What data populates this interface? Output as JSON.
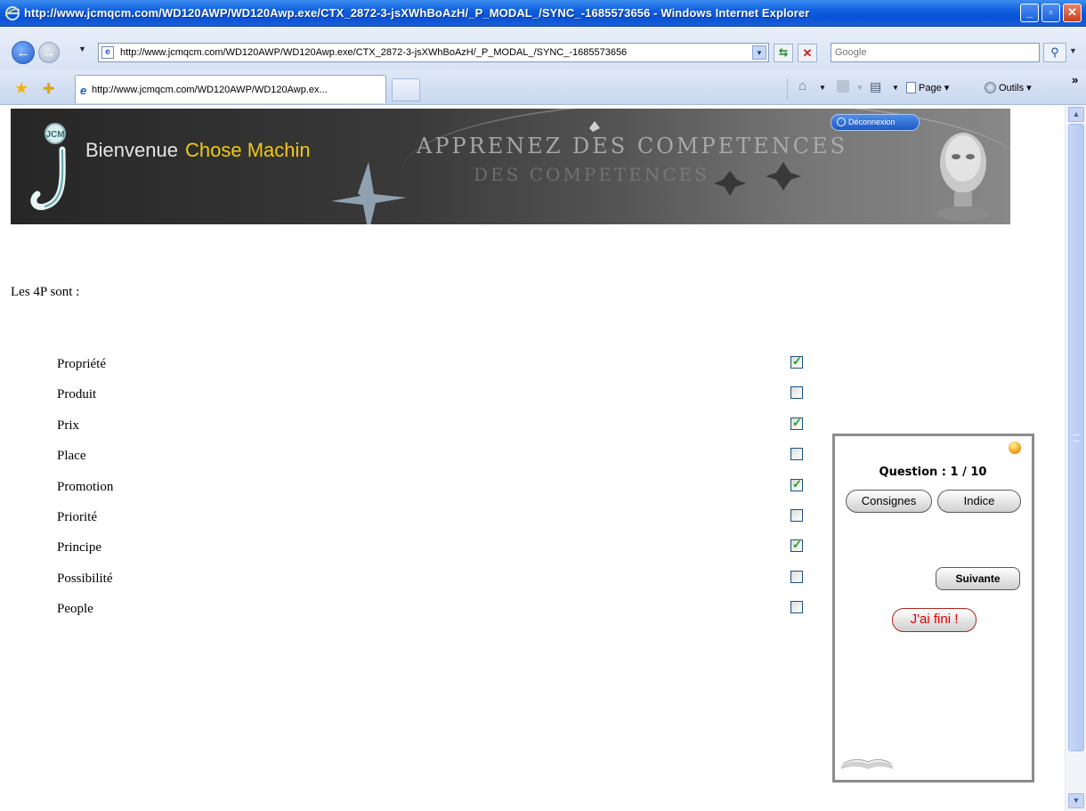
{
  "window": {
    "title": "http://www.jcmqcm.com/WD120AWP/WD120Awp.exe/CTX_2872-3-jsXWhBoAzH/_P_MODAL_/SYNC_-1685573656 - Windows Internet Explorer"
  },
  "address_bar": {
    "url": "http://www.jcmqcm.com/WD120AWP/WD120Awp.exe/CTX_2872-3-jsXWhBoAzH/_P_MODAL_/SYNC_-1685573656",
    "search_placeholder": "Google"
  },
  "tabs": {
    "active_label": "http://www.jcmqcm.com/WD120AWP/WD120Awp.ex..."
  },
  "command_bar": {
    "page_label": "Page",
    "tools_label": "Outils"
  },
  "banner": {
    "welcome": "Bienvenue",
    "user_name": "Chose Machin",
    "slogan": "APPRENEZ DES COMPETENCES",
    "slogan_reflection": "DES COMPETENCES",
    "logo_letters": "JCM",
    "logout_label": "Déconnexion"
  },
  "quiz": {
    "question": "Les 4P sont :",
    "answers": [
      {
        "label": "Propriété",
        "checked": true
      },
      {
        "label": "Produit",
        "checked": false
      },
      {
        "label": "Prix",
        "checked": true
      },
      {
        "label": "Place",
        "checked": false
      },
      {
        "label": "Promotion",
        "checked": true
      },
      {
        "label": "Priorité",
        "checked": false
      },
      {
        "label": "Principe",
        "checked": true
      },
      {
        "label": "Possibilité",
        "checked": false
      },
      {
        "label": "People",
        "checked": false
      }
    ]
  },
  "panel": {
    "counter": "Question : 1 / 10",
    "consignes_label": "Consignes",
    "indice_label": "Indice",
    "suivante_label": "Suivante",
    "fini_label": "J'ai fini !"
  },
  "colors": {
    "titlebar": "#0a52d8",
    "user_name": "#f0c814",
    "checkmark": "#21a121",
    "fini_text": "#e00000"
  }
}
